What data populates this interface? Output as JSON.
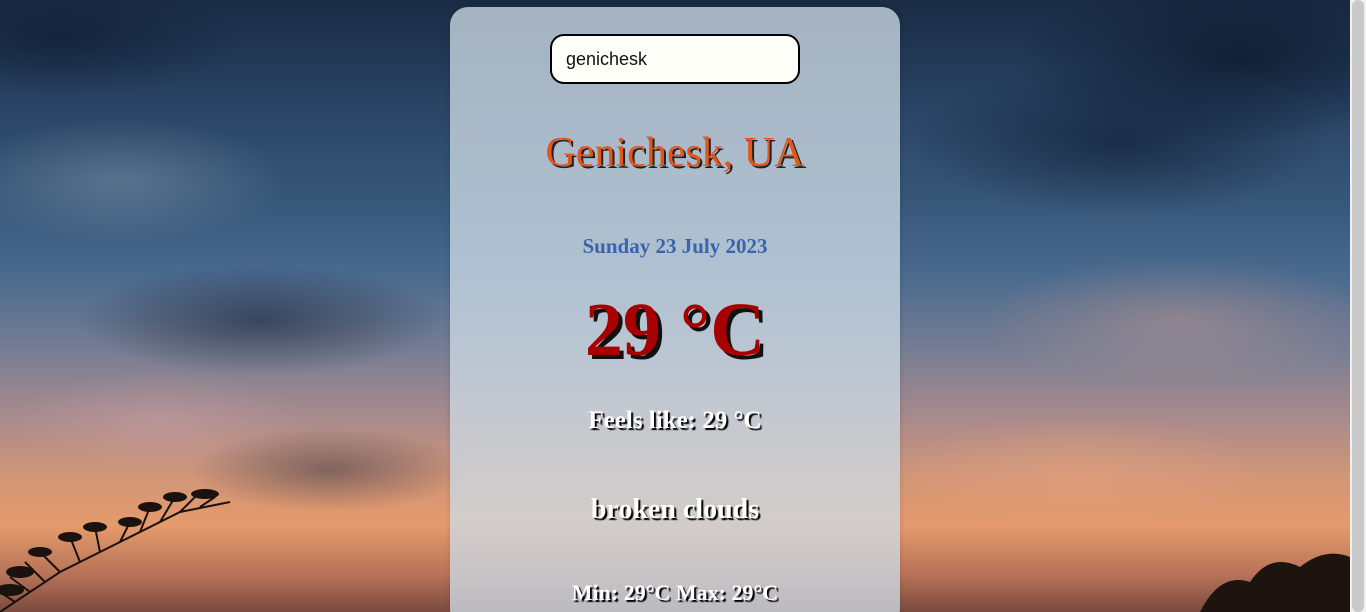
{
  "search": {
    "value": "genichesk"
  },
  "weather": {
    "location": "Genichesk, UA",
    "date": "Sunday 23 July 2023",
    "temperature": "29 °C",
    "feels_like": "Feels like: 29 °C",
    "description": "broken clouds",
    "min_max": "Min: 29°C Max: 29°C"
  },
  "colors": {
    "city_text": "#e0561b",
    "date_text": "#3b64ad",
    "temp_text": "#a80000",
    "card_bg": "#cddae4"
  }
}
